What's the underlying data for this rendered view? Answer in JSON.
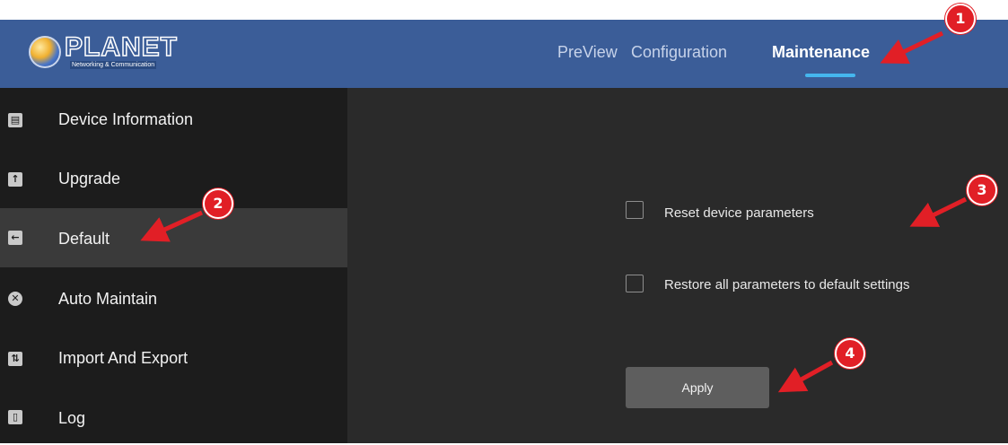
{
  "header": {
    "logo_text": "PLANET",
    "logo_subtext": "Networking & Communication",
    "tabs": [
      {
        "label": "PreView"
      },
      {
        "label": "Configuration"
      },
      {
        "label": "Maintenance",
        "active": true
      }
    ]
  },
  "sidebar": {
    "items": [
      {
        "label": "Device Information",
        "icon": "device-info-icon"
      },
      {
        "label": "Upgrade",
        "icon": "upgrade-icon"
      },
      {
        "label": "Default",
        "icon": "default-icon",
        "active": true
      },
      {
        "label": "Auto Maintain",
        "icon": "wrench-icon"
      },
      {
        "label": "Import And Export",
        "icon": "import-export-icon"
      },
      {
        "label": "Log",
        "icon": "log-icon"
      }
    ]
  },
  "main": {
    "options": [
      {
        "label": "Reset device parameters",
        "checked": false
      },
      {
        "label": "Restore all parameters to default settings",
        "checked": false
      }
    ],
    "apply_label": "Apply"
  },
  "annotations": {
    "markers": [
      "1",
      "2",
      "3",
      "4"
    ],
    "color": "#e11f26"
  },
  "colors": {
    "header_bg": "#3b5d98",
    "active_underline": "#45b6ee",
    "sidebar_bg": "#1c1c1c",
    "sidebar_active_bg": "#3a3a3a",
    "main_bg": "#2a2a2a"
  }
}
